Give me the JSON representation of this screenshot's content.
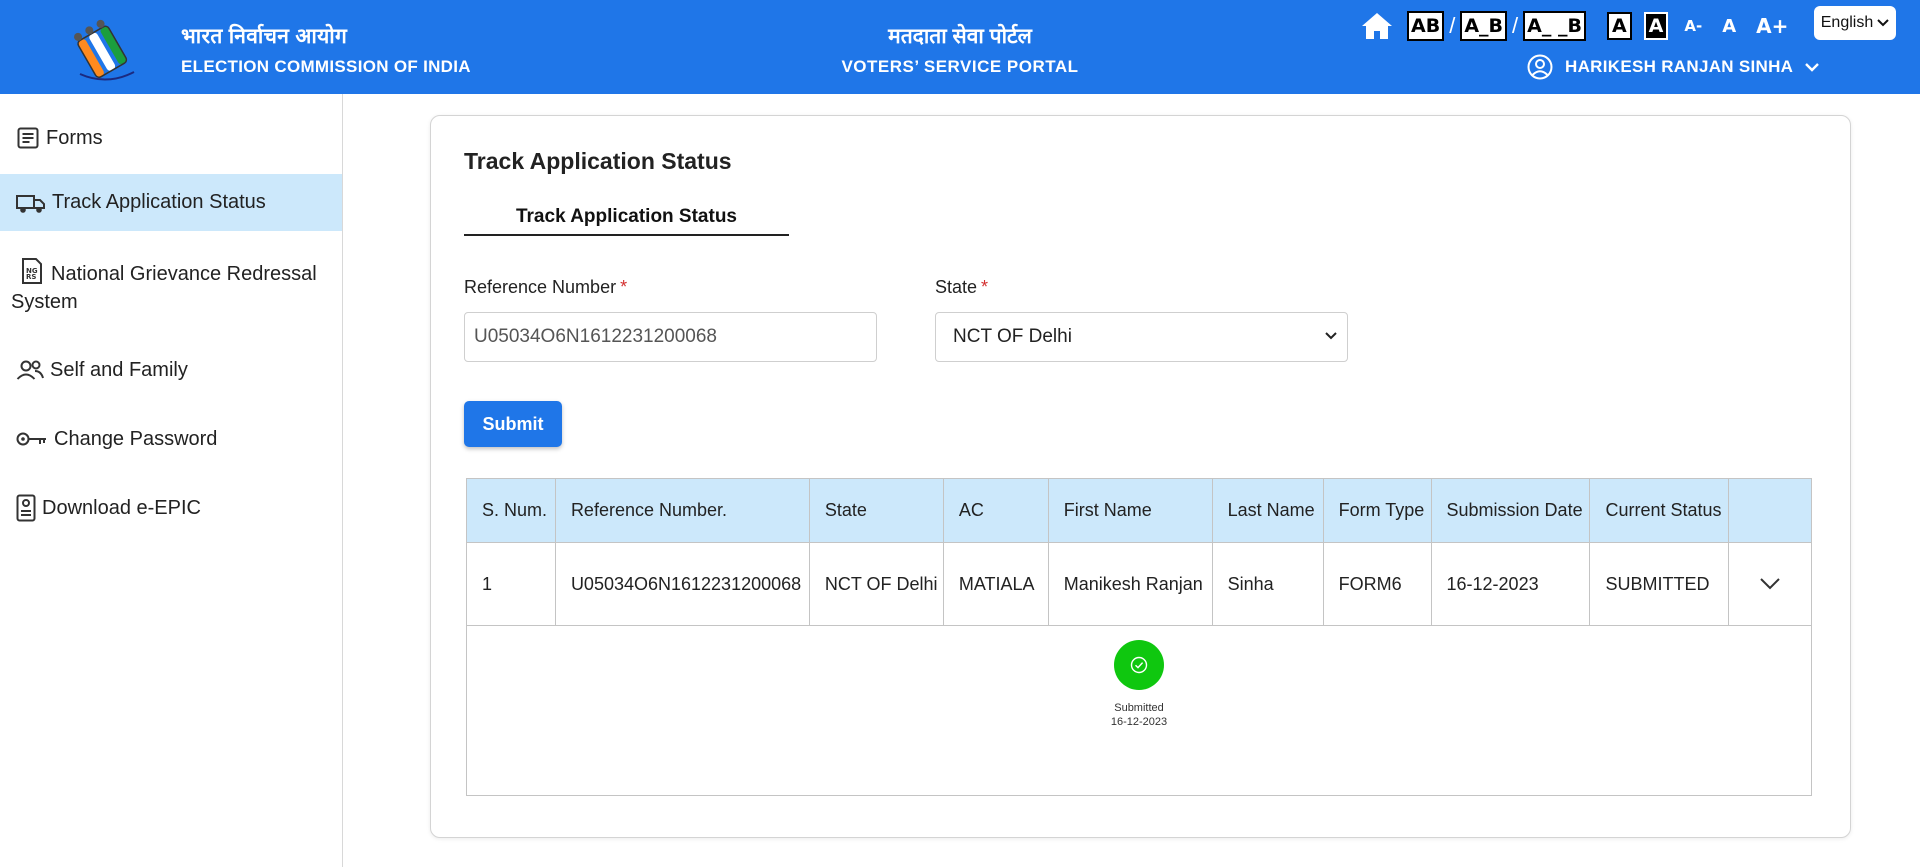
{
  "header": {
    "org_hindi": "भारत निर्वाचन आयोग",
    "org_english": "ELECTION COMMISSION OF INDIA",
    "portal_hindi": "मतदाता सेवा पोर्टल",
    "portal_english": "VOTERS’ SERVICE PORTAL",
    "spacing_options": [
      "AB",
      "A_B",
      "A_ _B"
    ],
    "contrast_options": [
      "A",
      "A"
    ],
    "font_size_options": [
      "A-",
      "A",
      "A+"
    ],
    "language": "English",
    "user_name": "HARIKESH RANJAN SINHA",
    "brand_color": "#1f76e8"
  },
  "sidebar": {
    "items": [
      {
        "label": "Forms",
        "icon": "forms-icon"
      },
      {
        "label": "Track Application Status",
        "icon": "truck-icon",
        "active": true
      },
      {
        "label": "National Grievance Redressal System",
        "icon": "grievance-document-icon"
      },
      {
        "label": "Self and Family",
        "icon": "users-icon"
      },
      {
        "label": "Change Password",
        "icon": "key-icon"
      },
      {
        "label": "Download e-EPIC",
        "icon": "id-card-icon"
      }
    ],
    "active_color": "#cce8fb"
  },
  "main": {
    "title": "Track Application Status",
    "tab_label": "Track Application Status",
    "reference_label": "Reference Number",
    "reference_value": "U05034O6N1612231200068",
    "state_label": "State",
    "required_mark": "*",
    "state_value": "NCT OF Delhi",
    "submit_label": "Submit"
  },
  "table": {
    "headers": [
      "S. Num.",
      "Reference Number.",
      "State",
      "AC",
      "First Name",
      "Last Name",
      "Form Type",
      "Submission Date",
      "Current Status",
      ""
    ],
    "rows": [
      [
        "1",
        "U05034O6N1612231200068",
        "NCT OF Delhi",
        "MATIALA",
        "Manikesh Ranjan",
        "Sinha",
        "FORM6",
        "16-12-2023",
        "SUBMITTED"
      ]
    ]
  },
  "timeline": {
    "status": "Submitted",
    "date": "16-12-2023",
    "color": "#0fc70f"
  }
}
